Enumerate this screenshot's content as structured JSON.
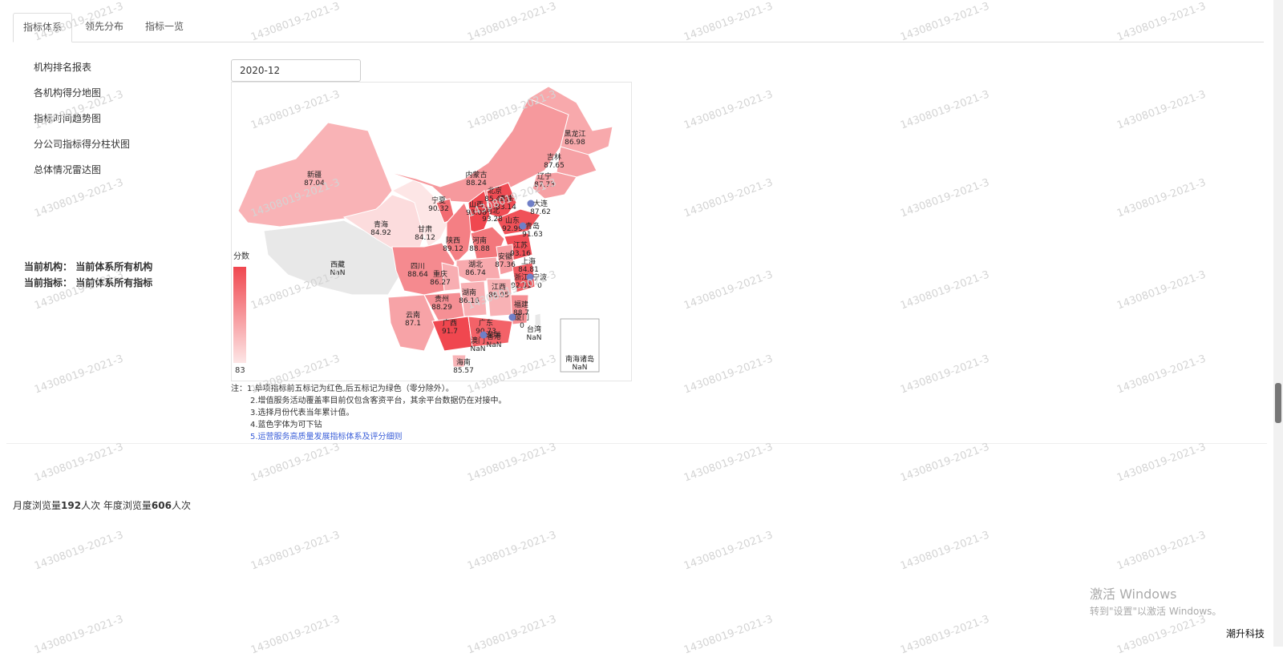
{
  "tabs": [
    {
      "label": "指标体系",
      "active": true
    },
    {
      "label": "领先分布",
      "active": false
    },
    {
      "label": "指标一览",
      "active": false
    }
  ],
  "sidebar": {
    "items": [
      "机构排名报表",
      "各机构得分地图",
      "指标时间趋势图",
      "分公司指标得分柱状图",
      "总体情况雷达图"
    ]
  },
  "current": {
    "org_label": "当前机构：",
    "org_value": "当前体系所有机构",
    "indicator_label": "当前指标：",
    "indicator_value": "当前体系所有指标"
  },
  "date_picker": {
    "value": "2020-12"
  },
  "map": {
    "legend_title": "分数",
    "legend_min": "83",
    "colors": {
      "high": "#f0474f",
      "low": "#fde6e6",
      "nan": "#e8e8e8",
      "city": "#6f7fc7"
    },
    "regions": [
      {
        "name": "黑龙江",
        "value": "86.98"
      },
      {
        "name": "吉林",
        "value": "87.65"
      },
      {
        "name": "辽宁",
        "value": "87.73"
      },
      {
        "name": "内蒙古",
        "value": "88.24"
      },
      {
        "name": "新疆",
        "value": "87.04"
      },
      {
        "name": "西藏",
        "value": "NaN"
      },
      {
        "name": "青海",
        "value": "84.92"
      },
      {
        "name": "甘肃",
        "value": "84.12"
      },
      {
        "name": "宁夏",
        "value": "90.32"
      },
      {
        "name": "陕西",
        "value": "89.12"
      },
      {
        "name": "山西",
        "value": "93.08"
      },
      {
        "name": "北京",
        "value": "85.43"
      },
      {
        "name": "天津",
        "value": "83.14"
      },
      {
        "name": "河北",
        "value": "93.28"
      },
      {
        "name": "山东",
        "value": "92.99"
      },
      {
        "name": "河南",
        "value": "88.88"
      },
      {
        "name": "江苏",
        "value": "93.16"
      },
      {
        "name": "安徽",
        "value": "87.36"
      },
      {
        "name": "上海",
        "value": "84.81"
      },
      {
        "name": "浙江",
        "value": "92.31"
      },
      {
        "name": "湖北",
        "value": "86.74"
      },
      {
        "name": "四川",
        "value": "88.64"
      },
      {
        "name": "重庆",
        "value": "86.27"
      },
      {
        "name": "湖南",
        "value": "86.16"
      },
      {
        "name": "江西",
        "value": "86.05"
      },
      {
        "name": "贵州",
        "value": "88.29"
      },
      {
        "name": "云南",
        "value": "87.1"
      },
      {
        "name": "广西",
        "value": "91.7"
      },
      {
        "name": "广东",
        "value": "90.73"
      },
      {
        "name": "福建",
        "value": "88.7"
      },
      {
        "name": "海南",
        "value": "85.57"
      },
      {
        "name": "台湾",
        "value": "NaN"
      },
      {
        "name": "香港",
        "value": "NaN"
      },
      {
        "name": "澳门",
        "value": "NaN"
      },
      {
        "name": "南海诸岛",
        "value": "NaN"
      }
    ],
    "cities": [
      {
        "name": "大连",
        "value": "87.62"
      },
      {
        "name": "青岛",
        "value": "91.63"
      },
      {
        "name": "宁波",
        "value": "0"
      },
      {
        "name": "厦门",
        "value": "0"
      },
      {
        "name": "深圳",
        "value": ""
      }
    ]
  },
  "notes": {
    "prefix": "注：",
    "lines": [
      "1.单项指标前五标记为红色,后五标记为绿色（零分除外）。",
      "2.增值服务活动覆盖率目前仅包含客资平台，其余平台数据仍在对接中。",
      "3.选择月份代表当年累计值。",
      "4.蓝色字体为可下钻"
    ],
    "link": "5.运营服务高质量发展指标体系及评分细则"
  },
  "views": {
    "monthly_prefix": "月度浏览量",
    "monthly_count": "192",
    "monthly_suffix": "人次 年度浏览量",
    "yearly_count": "606",
    "yearly_suffix": "人次"
  },
  "windows": {
    "title": "激活 Windows",
    "subtitle": "转到\"设置\"以激活 Windows。"
  },
  "brand": "潮升科技",
  "watermark": "14308019-2021-3"
}
